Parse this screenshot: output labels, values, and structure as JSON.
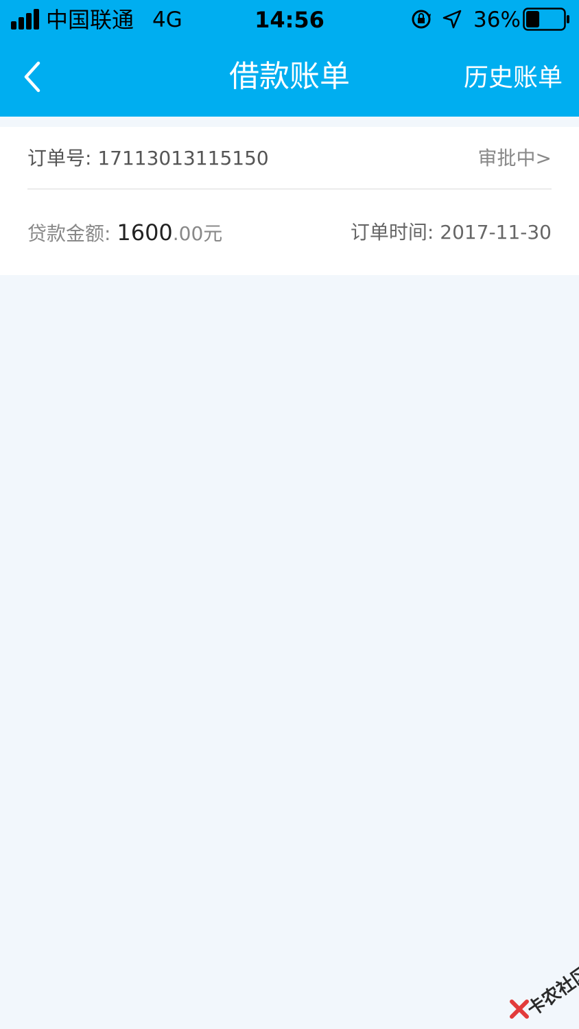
{
  "status_bar": {
    "carrier": "中国联通",
    "network": "4G",
    "time": "14:56",
    "battery_percent": "36%",
    "battery_level": 0.36
  },
  "nav": {
    "title": "借款账单",
    "right_button": "历史账单",
    "back_icon": "chevron-left-icon"
  },
  "order": {
    "order_no_label": "订单号: ",
    "order_no": "17113013115150",
    "status": "审批中>",
    "amount_label": "贷款金额: ",
    "amount_int": "1600",
    "amount_dec": ".00元",
    "time_label": "订单时间: ",
    "time": "2017-11-30"
  },
  "watermark": {
    "text": "卡农社区"
  },
  "colors": {
    "header_bg": "#00aef0",
    "page_bg": "#f2f7fc",
    "card_bg": "#ffffff"
  }
}
